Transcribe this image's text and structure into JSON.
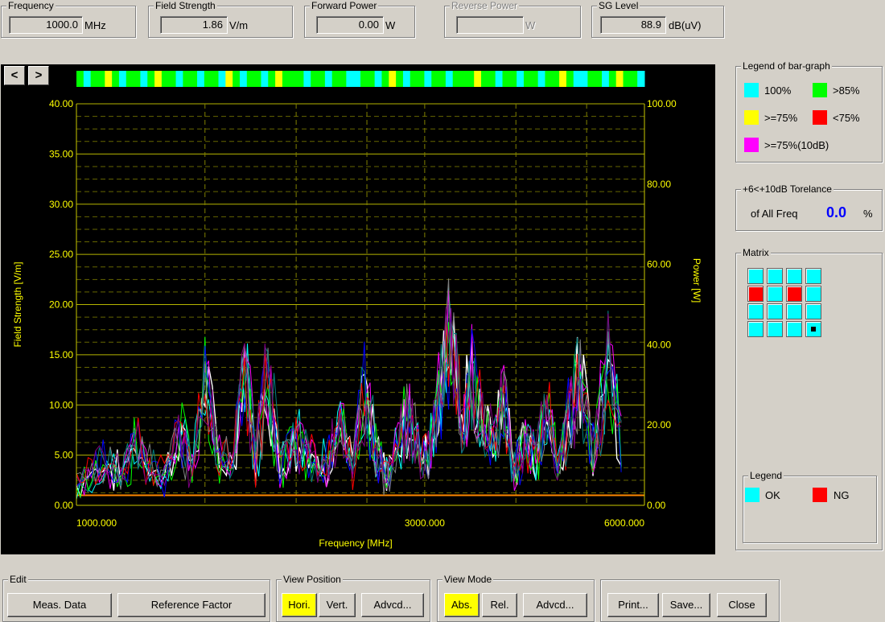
{
  "readouts": {
    "frequency": {
      "title": "Frequency",
      "value": "1000.0",
      "unit": "MHz"
    },
    "field_strength": {
      "title": "Field Strength",
      "value": "1.86",
      "unit": "V/m"
    },
    "forward_power": {
      "title": "Forward Power",
      "value": "0.00",
      "unit": "W"
    },
    "reverse_power": {
      "title": "Reverse Power",
      "value": "",
      "unit": "W"
    },
    "sg_level": {
      "title": "SG Level",
      "value": "88.9",
      "unit": "dB(uV)"
    }
  },
  "plot": {
    "prev_label": "<",
    "next_label": ">",
    "xlabel": "Frequency [MHz]",
    "ylabel_left": "Field Strength [V/m]",
    "ylabel_right": "Power [W]",
    "left_ticks": [
      "40.00",
      "35.00",
      "30.00",
      "25.00",
      "20.00",
      "15.00",
      "10.00",
      "5.00",
      "0.00"
    ],
    "right_ticks": [
      "100.00",
      "80.00",
      "60.00",
      "40.00",
      "20.00",
      "0.00"
    ],
    "x_ticks": [
      "1000.000",
      "3000.000",
      "6000.000"
    ],
    "colors": {
      "background": "#000000",
      "axis": "#c8c800",
      "grid": "#808000",
      "tick_text": "#ffff00",
      "limit_line": "#ff8800",
      "traces": [
        "#ffffff",
        "#00ffff",
        "#ff00ff",
        "#00ff00",
        "#0000ff",
        "#ff0000",
        "#808080",
        "#008080",
        "#800080"
      ]
    }
  },
  "chart_data": {
    "type": "line",
    "xlabel": "Frequency [MHz]",
    "ylabel": "Field Strength [V/m]",
    "y2label": "Power [W]",
    "xscale": "log",
    "xlim": [
      1000,
      6000
    ],
    "ylim": [
      0,
      40
    ],
    "y2lim": [
      0,
      100
    ],
    "grid": true,
    "series": [
      {
        "values": [
          2,
          3.5,
          4.5,
          3,
          6.5,
          4,
          3,
          8,
          4,
          12,
          5,
          4,
          16,
          5,
          14,
          4,
          7,
          6,
          4,
          5,
          8,
          4,
          12,
          6,
          3,
          7,
          9,
          5,
          6,
          13,
          19,
          8,
          14,
          9,
          6,
          11,
          4,
          7,
          5,
          10,
          4,
          9,
          13,
          6,
          15,
          4
        ]
      }
    ],
    "x": [
      1000,
      1050,
      1100,
      1150,
      1200,
      1260,
      1320,
      1380,
      1440,
      1500,
      1570,
      1640,
      1700,
      1760,
      1830,
      1900,
      1980,
      2060,
      2140,
      2220,
      2300,
      2390,
      2480,
      2570,
      2660,
      2760,
      2860,
      2960,
      3060,
      3160,
      3260,
      3370,
      3480,
      3600,
      3720,
      3850,
      3980,
      4120,
      4260,
      4410,
      4560,
      4720,
      4900,
      5100,
      5350,
      5650
    ]
  },
  "bar_graph": {
    "colors": [
      "#00ff00",
      "#00ffff",
      "#ffff00",
      "#ff0000"
    ]
  },
  "legend_bar": {
    "title": "Legend of bar-graph",
    "items": [
      {
        "label": "100%",
        "color": "#00ffff"
      },
      {
        "label": ">85%",
        "color": "#00ff00"
      },
      {
        "label": ">=75%",
        "color": "#ffff00"
      },
      {
        "label": "<75%",
        "color": "#ff0000"
      },
      {
        "label": ">=75%(10dB)",
        "color": "#ff00ff"
      }
    ]
  },
  "tolerance": {
    "title": "+6<+10dB Torelance",
    "label": "of All Freq",
    "value": "0.0",
    "unit": "%",
    "value_color": "#0000ff"
  },
  "matrix": {
    "title": "Matrix",
    "cells": [
      "ok",
      "ok",
      "ok",
      "ok",
      "ng",
      "ok",
      "ng",
      "ok",
      "ok",
      "ok",
      "ok",
      "ok",
      "ok",
      "ok",
      "ok",
      "current"
    ],
    "colors": {
      "ok": "#00ffff",
      "ng": "#ff0000"
    }
  },
  "legend_status": {
    "title": "Legend",
    "items": [
      {
        "label": "OK",
        "color": "#00ffff"
      },
      {
        "label": "NG",
        "color": "#ff0000"
      }
    ]
  },
  "edit": {
    "title": "Edit",
    "meas_data": "Meas. Data",
    "reference_factor": "Reference Factor"
  },
  "view_position": {
    "title": "View Position",
    "hori": "Hori.",
    "vert": "Vert.",
    "advcd": "Advcd...",
    "active": "hori"
  },
  "view_mode": {
    "title": "View Mode",
    "abs": "Abs.",
    "rel": "Rel.",
    "advcd": "Advcd...",
    "active": "abs"
  },
  "actions": {
    "print": "Print...",
    "save": "Save...",
    "close": "Close"
  }
}
